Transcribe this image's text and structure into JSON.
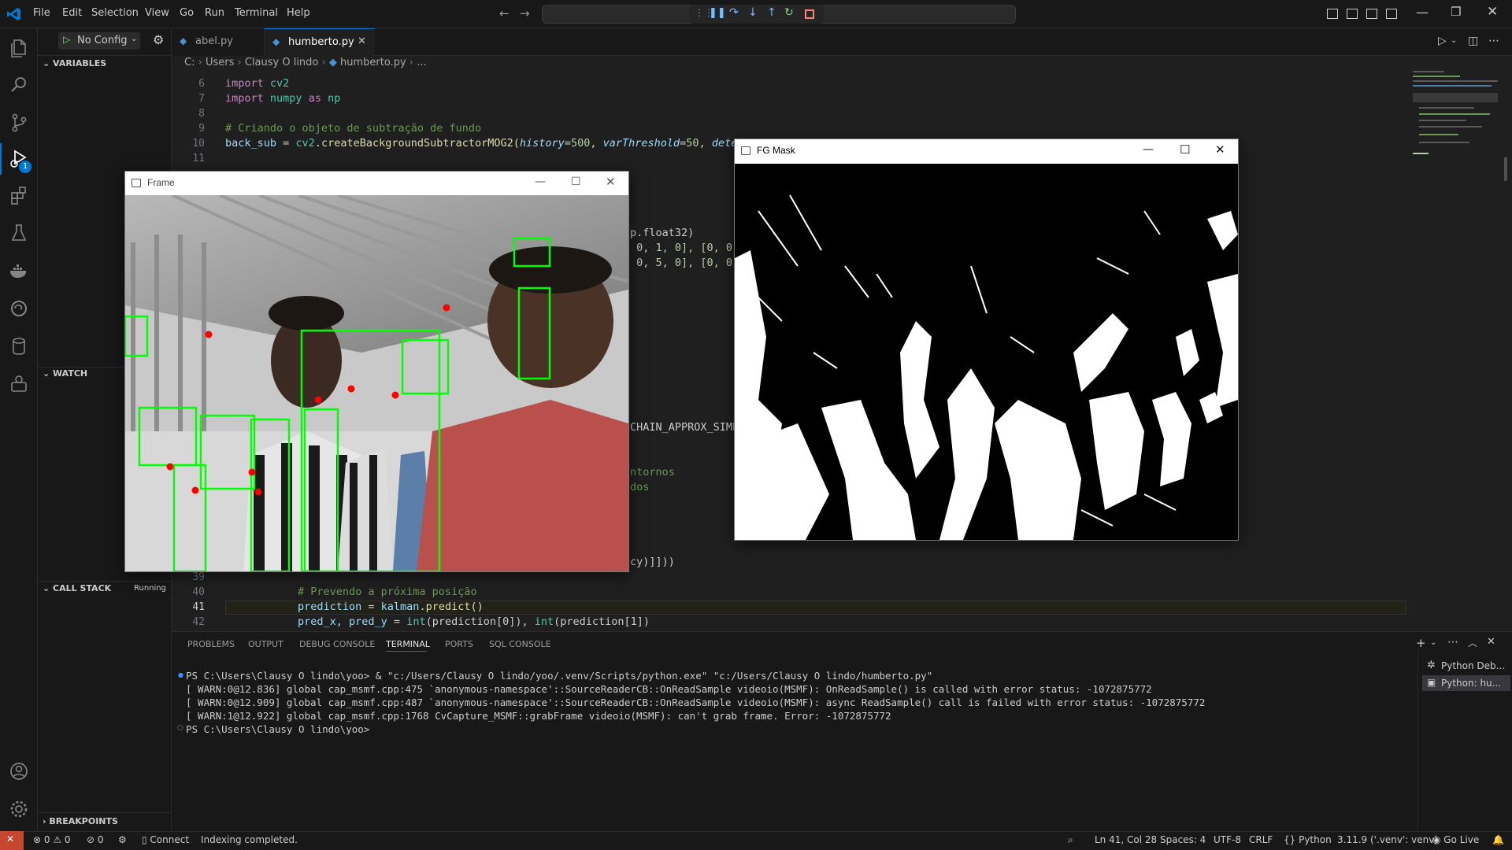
{
  "menu": [
    "File",
    "Edit",
    "Selection",
    "View",
    "Go",
    "Run",
    "Terminal",
    "Help"
  ],
  "debug": {
    "config_label": "No Config"
  },
  "tabs": [
    {
      "label": "abel.py"
    },
    {
      "label": "humberto.py"
    }
  ],
  "breadcrumb": {
    "c": "C:",
    "users": "Users",
    "user": "Clausy O lindo",
    "file": "humberto.py",
    "more": "..."
  },
  "sidebar": {
    "variables": "VARIABLES",
    "watch": "WATCH",
    "call_stack": "CALL STACK",
    "call_stack_status": "Running",
    "breakpoints": "BREAKPOINTS"
  },
  "activity_badge": "1",
  "code": {
    "line_numbers": [
      "6",
      "7",
      "8",
      "9",
      "10",
      "11",
      "39",
      "40",
      "41",
      "42"
    ],
    "l6_kw": "import",
    "l6_mod": "cv2",
    "l7_kw": "import",
    "l7_mod": "numpy",
    "l7_as": "as",
    "l7_alias": "np",
    "l9_comment": "# Criando o objeto de subtração de fundo",
    "l10_var": "back_sub",
    "l10_eq": " = ",
    "l10_mod": "cv2",
    "l10_fn": ".createBackgroundSubtractorMOG2(",
    "l10_p1": "history",
    "l10_v1": "500",
    "l10_p2": "varThreshold",
    "l10_v2": "50",
    "l10_p3": "detectSh",
    "peek1": "p.float32)",
    "peek2": " 0, 1, 0], [0, 0,",
    "peek3": " 0, 5, 0], [0, 0,",
    "peek4": "CHAIN_APPROX_SIMP",
    "peek5": "ntornos",
    "peek6": "dos",
    "peek7": "cy)]]))",
    "l40_comment": "# Prevendo a próxima posição",
    "l41_var": "prediction",
    "l41_eq": " = ",
    "l41_obj": "kalman",
    "l41_fn": ".predict()",
    "l42_a": "pred_x, pred_y",
    "l42_eq": " = ",
    "l42_int": "int",
    "l42_b": "(prediction[0]), ",
    "l42_int2": "int",
    "l42_c": "(prediction[1])"
  },
  "panel": {
    "tabs": [
      "PROBLEMS",
      "OUTPUT",
      "DEBUG CONSOLE",
      "TERMINAL",
      "PORTS",
      "SQL CONSOLE"
    ],
    "terminal": [
      "PS C:\\Users\\Clausy O lindo\\yoo> & \"c:/Users/Clausy O lindo/yoo/.venv/Scripts/python.exe\" \"c:/Users/Clausy O lindo/humberto.py\"",
      "[ WARN:0@12.836] global cap_msmf.cpp:475 `anonymous-namespace'::SourceReaderCB::OnReadSample videoio(MSMF): OnReadSample() is called with error status: -1072875772",
      "[ WARN:0@12.909] global cap_msmf.cpp:487 `anonymous-namespace'::SourceReaderCB::OnReadSample videoio(MSMF): async ReadSample() call is failed with error status: -1072875772",
      "[ WARN:1@12.922] global cap_msmf.cpp:1768 CvCapture_MSMF::grabFrame videoio(MSMF): can't grab frame. Error: -1072875772",
      "PS C:\\Users\\Clausy O lindo\\yoo>"
    ],
    "sessions": [
      "Python Deb...",
      "Python: hu..."
    ]
  },
  "statusbar": {
    "errors": "0",
    "warnings": "0",
    "ports": "0",
    "connect": "Connect",
    "indexing": "Indexing completed.",
    "position": "Ln 41, Col 28",
    "spaces": "Spaces: 4",
    "encoding": "UTF-8",
    "eol": "CRLF",
    "language": "Python",
    "interpreter": "3.11.9 ('.venv': venv)",
    "golive": "Go Live"
  },
  "windows": {
    "frame_title": "Frame",
    "fgmask_title": "FG Mask"
  },
  "colors": {
    "accent": "#0078d4",
    "box": "#00ff00",
    "dot": "#ff0000"
  }
}
